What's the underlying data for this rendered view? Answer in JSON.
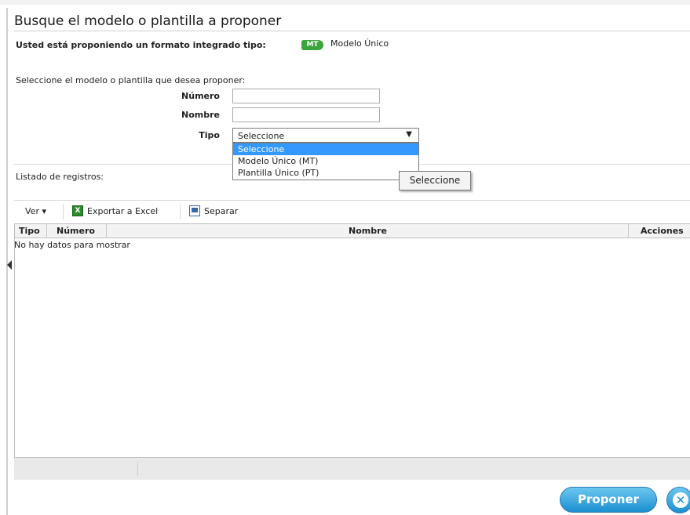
{
  "page": {
    "title": "Busque el modelo o plantilla a proponer"
  },
  "format": {
    "label": "Usted está proponiendo un formato integrado tipo:",
    "badge": "MT",
    "value": "Modelo Único",
    "badge_color": "#3ba43b"
  },
  "search": {
    "instruction": "Seleccione el modelo o plantilla que desea proponer:",
    "numero_label": "Número",
    "numero_value": "",
    "nombre_label": "Nombre",
    "nombre_value": "",
    "tipo_label": "Tipo",
    "tipo_selected": "Seleccione",
    "tipo_options": [
      "Seleccione",
      "Modelo Único (MT)",
      "Plantilla Único (PT)"
    ],
    "tooltip": "Seleccione"
  },
  "records": {
    "label": "Listado de registros:",
    "toolbar": {
      "ver": "Ver ▾",
      "export": "Exportar a Excel",
      "separate": "Separar"
    },
    "columns": [
      "Tipo",
      "Número",
      "Nombre",
      "Acciones"
    ],
    "empty_message": "No hay datos para mostrar"
  },
  "actions": {
    "propose": "Proponer",
    "close_icon": "close-icon"
  },
  "colors": {
    "accent": "#1b8fd0",
    "selection": "#3399ff"
  }
}
